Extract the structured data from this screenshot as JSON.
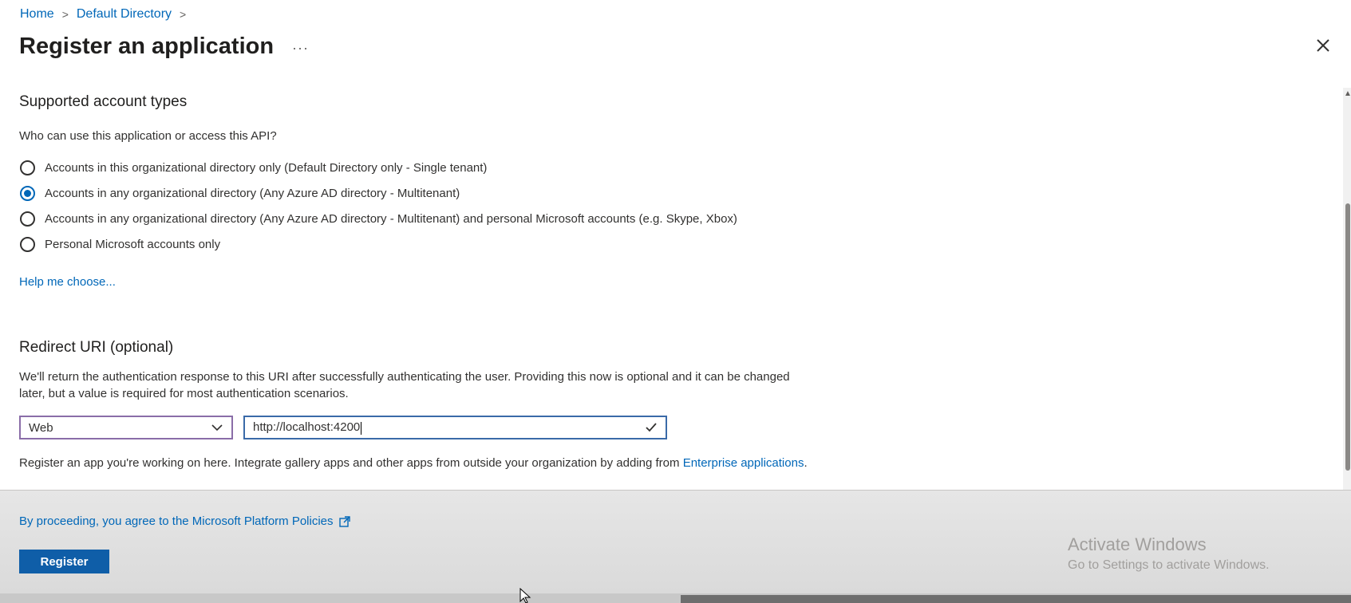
{
  "breadcrumb": {
    "items": [
      "Home",
      "Default Directory"
    ],
    "separator": ">"
  },
  "title": "Register an application",
  "more_label": "···",
  "account_types": {
    "header": "Supported account types",
    "question": "Who can use this application or access this API?",
    "options": [
      {
        "label": "Accounts in this organizational directory only (Default Directory only - Single tenant)",
        "checked": false
      },
      {
        "label": "Accounts in any organizational directory (Any Azure AD directory - Multitenant)",
        "checked": true
      },
      {
        "label": "Accounts in any organizational directory (Any Azure AD directory - Multitenant) and personal Microsoft accounts (e.g. Skype, Xbox)",
        "checked": false
      },
      {
        "label": "Personal Microsoft accounts only",
        "checked": false
      }
    ],
    "help_link": "Help me choose..."
  },
  "redirect": {
    "header": "Redirect URI (optional)",
    "description": "We'll return the authentication response to this URI after successfully authenticating the user. Providing this now is optional and it can be changed later, but a value is required for most authentication scenarios.",
    "platform_value": "Web",
    "uri_value": "http://localhost:4200"
  },
  "register_note": {
    "text": "Register an app you're working on here. Integrate gallery apps and other apps from outside your organization by adding from ",
    "link": "Enterprise applications",
    "suffix": "."
  },
  "footer": {
    "policy_link": "By proceeding, you agree to the Microsoft Platform Policies",
    "register_button": "Register"
  },
  "watermark": {
    "title": "Activate Windows",
    "subtitle": "Go to Settings to activate Windows."
  },
  "colors": {
    "link": "#0067b8",
    "primary_button": "#0f5ea8",
    "radio_selected": "#0067b8"
  }
}
